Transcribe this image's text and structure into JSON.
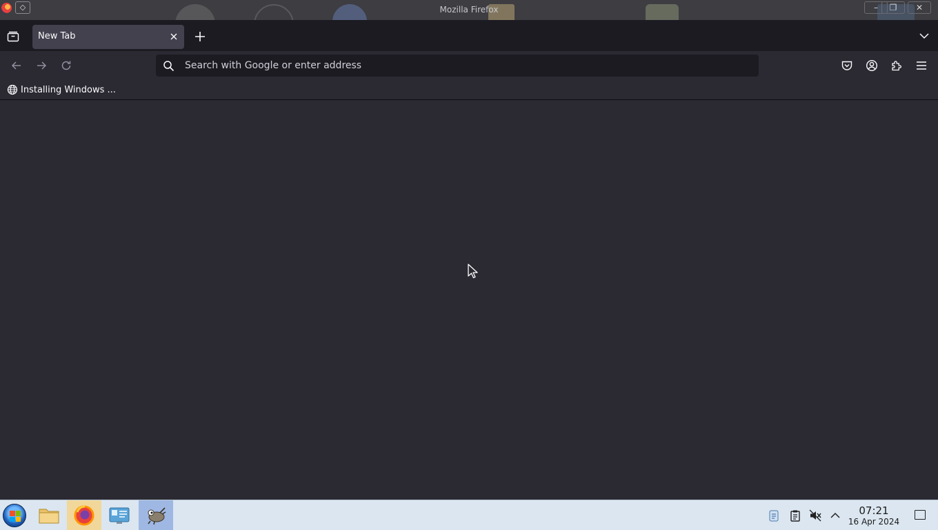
{
  "window": {
    "title": "Mozilla Firefox"
  },
  "tabs": [
    {
      "label": "New Tab"
    }
  ],
  "urlbar": {
    "placeholder": "Search with Google or enter address",
    "value": ""
  },
  "bookmarks": [
    {
      "label": "Installing Windows ..."
    }
  ],
  "taskbar": {
    "time": "07:21",
    "date": "16 Apr 2024"
  },
  "icons": {
    "tab_list": "tab-list-icon",
    "close_tab": "close-icon",
    "new_tab": "plus-icon",
    "list_all_tabs": "chevron-down-icon",
    "back": "arrow-left-icon",
    "forward": "arrow-right-icon",
    "reload": "reload-icon",
    "search": "search-icon",
    "pocket": "pocket-icon",
    "account": "account-icon",
    "extensions": "puzzle-icon",
    "menu": "hamburger-menu-icon",
    "bookmark": "globe-icon"
  },
  "colors": {
    "toolbar_bg": "#2b2a33",
    "tabstrip_bg": "#1c1b22",
    "selected_tab": "#42414d",
    "taskbar_bg": "#dbe6f0"
  }
}
